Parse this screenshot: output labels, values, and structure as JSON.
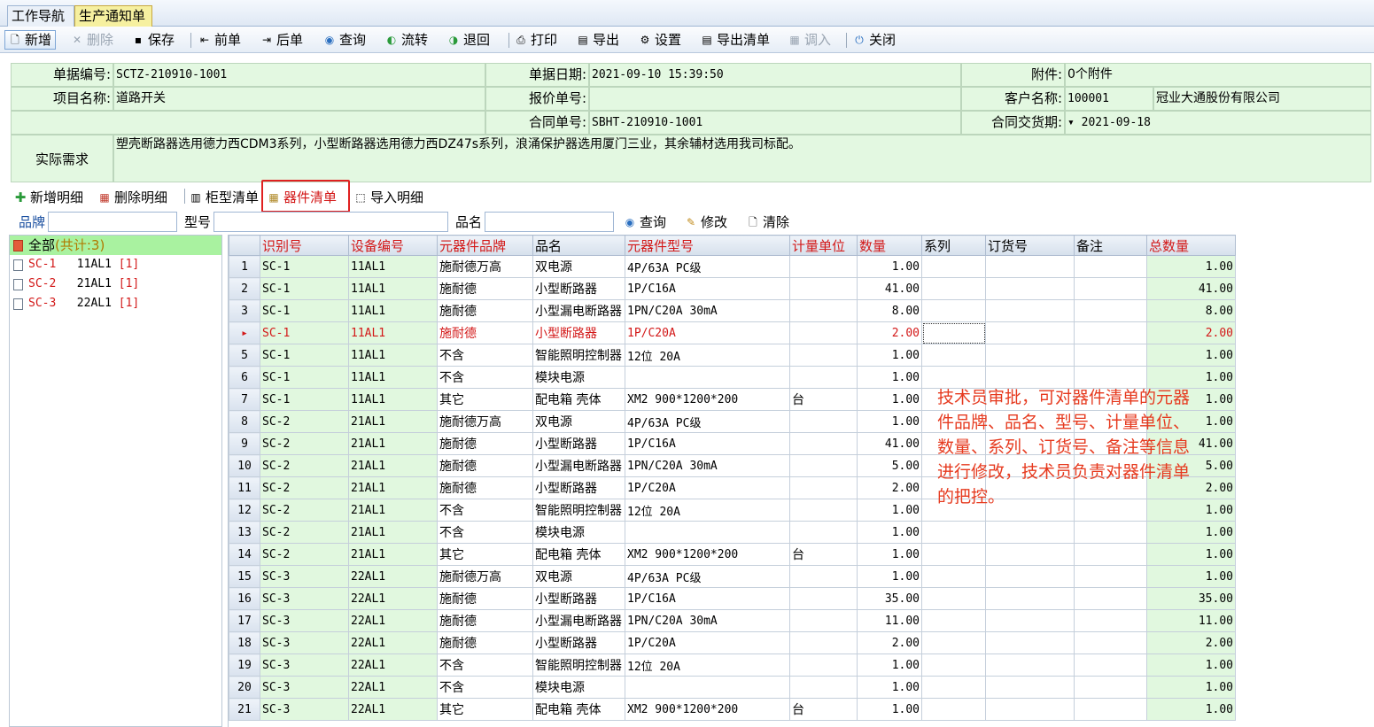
{
  "tabs": [
    {
      "label": "工作导航"
    },
    {
      "label": "生产通知单"
    }
  ],
  "toolbar": {
    "new": "新增",
    "delete": "删除",
    "save": "保存",
    "prev": "前单",
    "next": "后单",
    "query": "查询",
    "flow": "流转",
    "back": "退回",
    "print": "打印",
    "export": "导出",
    "settings": "设置",
    "export_list": "导出清单",
    "import": "调入",
    "close": "关闭"
  },
  "form": {
    "doc_no_label": "单据编号:",
    "doc_no": "SCTZ-210910-1001",
    "doc_date_label": "单据日期:",
    "doc_date": "2021-09-10 15:39:50",
    "attach_label": "附件:",
    "attach": "0个附件",
    "project_label": "项目名称:",
    "project": "道路开关",
    "quote_label": "报价单号:",
    "quote": "",
    "customer_label": "客户名称:",
    "customer_code": "100001",
    "customer_name": "冠业大通股份有限公司",
    "contract_label": "合同单号:",
    "contract": "SBHT-210910-1001",
    "delivery_label": "合同交货期:",
    "delivery": "▾ 2021-09-18",
    "demand_label": "实际需求",
    "demand": "塑壳断路器选用德力西CDM3系列，小型断路器选用德力西DZ47s系列，浪涌保护器选用厦门三业，其余辅材选用我司标配。"
  },
  "detail_toolbar": {
    "add": "新增明细",
    "remove": "删除明细",
    "cabinet": "柜型清单",
    "parts": "器件清单",
    "import": "导入明细"
  },
  "filter": {
    "brand": "品牌",
    "model": "型号",
    "name": "品名",
    "query": "查询",
    "edit": "修改",
    "clear": "清除"
  },
  "tree": {
    "root_label": "全部",
    "root_count": "(共计:3)",
    "items": [
      {
        "id": "SC-1",
        "code": "11AL1",
        "count": "[1]"
      },
      {
        "id": "SC-2",
        "code": "21AL1",
        "count": "[1]"
      },
      {
        "id": "SC-3",
        "code": "22AL1",
        "count": "[1]"
      }
    ]
  },
  "grid": {
    "columns": [
      "识别号",
      "设备编号",
      "元器件品牌",
      "品名",
      "元器件型号",
      "计量单位",
      "数量",
      "系列",
      "订货号",
      "备注",
      "总数量"
    ],
    "rows": [
      {
        "n": "1",
        "id": "SC-1",
        "dev": "11AL1",
        "brand": "施耐德万高",
        "name": "双电源",
        "model": "4P/63A PC级",
        "unit": "",
        "qty": "1.00",
        "total": "1.00"
      },
      {
        "n": "2",
        "id": "SC-1",
        "dev": "11AL1",
        "brand": "施耐德",
        "name": "小型断路器",
        "model": "1P/C16A",
        "unit": "",
        "qty": "41.00",
        "total": "41.00"
      },
      {
        "n": "3",
        "id": "SC-1",
        "dev": "11AL1",
        "brand": "施耐德",
        "name": "小型漏电断路器",
        "model": "1PN/C20A 30mA",
        "unit": "",
        "qty": "8.00",
        "total": "8.00"
      },
      {
        "n": "▸",
        "id": "SC-1",
        "dev": "11AL1",
        "brand": "施耐德",
        "name": "小型断路器",
        "model": "1P/C20A",
        "unit": "",
        "qty": "2.00",
        "total": "2.00"
      },
      {
        "n": "5",
        "id": "SC-1",
        "dev": "11AL1",
        "brand": "不含",
        "name": "智能照明控制器",
        "model": "12位 20A",
        "unit": "",
        "qty": "1.00",
        "total": "1.00"
      },
      {
        "n": "6",
        "id": "SC-1",
        "dev": "11AL1",
        "brand": "不含",
        "name": "模块电源",
        "model": "",
        "unit": "",
        "qty": "1.00",
        "total": "1.00"
      },
      {
        "n": "7",
        "id": "SC-1",
        "dev": "11AL1",
        "brand": "其它",
        "name": "配电箱 壳体",
        "model": "XM2 900*1200*200",
        "unit": "台",
        "qty": "1.00",
        "total": "1.00"
      },
      {
        "n": "8",
        "id": "SC-2",
        "dev": "21AL1",
        "brand": "施耐德万高",
        "name": "双电源",
        "model": "4P/63A PC级",
        "unit": "",
        "qty": "1.00",
        "total": "1.00"
      },
      {
        "n": "9",
        "id": "SC-2",
        "dev": "21AL1",
        "brand": "施耐德",
        "name": "小型断路器",
        "model": "1P/C16A",
        "unit": "",
        "qty": "41.00",
        "total": "41.00"
      },
      {
        "n": "10",
        "id": "SC-2",
        "dev": "21AL1",
        "brand": "施耐德",
        "name": "小型漏电断路器",
        "model": "1PN/C20A 30mA",
        "unit": "",
        "qty": "5.00",
        "total": "5.00"
      },
      {
        "n": "11",
        "id": "SC-2",
        "dev": "21AL1",
        "brand": "施耐德",
        "name": "小型断路器",
        "model": "1P/C20A",
        "unit": "",
        "qty": "2.00",
        "total": "2.00"
      },
      {
        "n": "12",
        "id": "SC-2",
        "dev": "21AL1",
        "brand": "不含",
        "name": "智能照明控制器",
        "model": "12位 20A",
        "unit": "",
        "qty": "1.00",
        "total": "1.00"
      },
      {
        "n": "13",
        "id": "SC-2",
        "dev": "21AL1",
        "brand": "不含",
        "name": "模块电源",
        "model": "",
        "unit": "",
        "qty": "1.00",
        "total": "1.00"
      },
      {
        "n": "14",
        "id": "SC-2",
        "dev": "21AL1",
        "brand": "其它",
        "name": "配电箱 壳体",
        "model": "XM2 900*1200*200",
        "unit": "台",
        "qty": "1.00",
        "total": "1.00"
      },
      {
        "n": "15",
        "id": "SC-3",
        "dev": "22AL1",
        "brand": "施耐德万高",
        "name": "双电源",
        "model": "4P/63A PC级",
        "unit": "",
        "qty": "1.00",
        "total": "1.00"
      },
      {
        "n": "16",
        "id": "SC-3",
        "dev": "22AL1",
        "brand": "施耐德",
        "name": "小型断路器",
        "model": "1P/C16A",
        "unit": "",
        "qty": "35.00",
        "total": "35.00"
      },
      {
        "n": "17",
        "id": "SC-3",
        "dev": "22AL1",
        "brand": "施耐德",
        "name": "小型漏电断路器",
        "model": "1PN/C20A 30mA",
        "unit": "",
        "qty": "11.00",
        "total": "11.00"
      },
      {
        "n": "18",
        "id": "SC-3",
        "dev": "22AL1",
        "brand": "施耐德",
        "name": "小型断路器",
        "model": "1P/C20A",
        "unit": "",
        "qty": "2.00",
        "total": "2.00"
      },
      {
        "n": "19",
        "id": "SC-3",
        "dev": "22AL1",
        "brand": "不含",
        "name": "智能照明控制器",
        "model": "12位 20A",
        "unit": "",
        "qty": "1.00",
        "total": "1.00"
      },
      {
        "n": "20",
        "id": "SC-3",
        "dev": "22AL1",
        "brand": "不含",
        "name": "模块电源",
        "model": "",
        "unit": "",
        "qty": "1.00",
        "total": "1.00"
      },
      {
        "n": "21",
        "id": "SC-3",
        "dev": "22AL1",
        "brand": "其它",
        "name": "配电箱 壳体",
        "model": "XM2 900*1200*200",
        "unit": "台",
        "qty": "1.00",
        "total": "1.00"
      }
    ]
  },
  "note": "技术员审批，可对器件清单的元器件品牌、品名、型号、计量单位、数量、系列、订货号、备注等信息进行修改，技术员负责对器件清单的把控。",
  "colors": {
    "form_bg": "#e3f8e1",
    "highlight_red": "#d31818",
    "note_red": "#e63a1f",
    "tree_root": "#a9f2a0"
  }
}
